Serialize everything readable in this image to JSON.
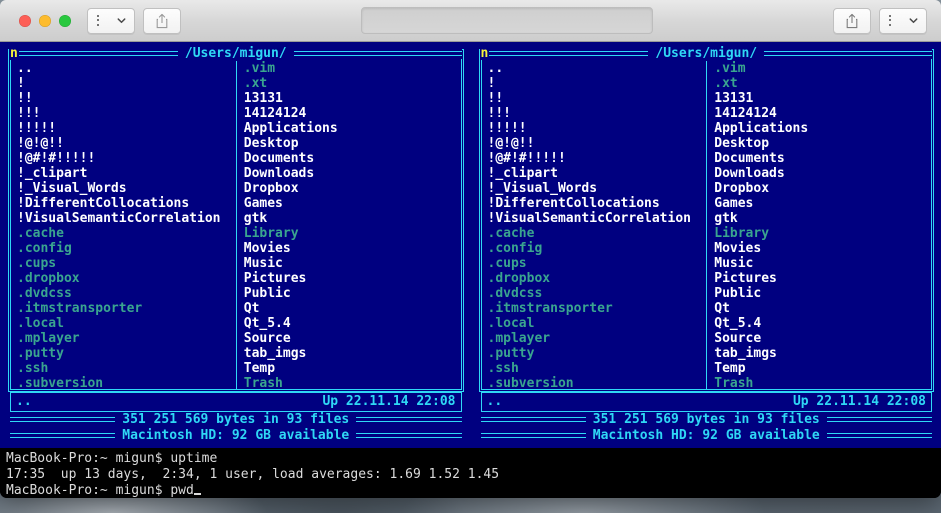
{
  "window": {
    "titlebar": {
      "traffic_lights": [
        "close",
        "minimize",
        "zoom"
      ],
      "left_menu_button": "list-menu",
      "left_share_button": "share",
      "center_field_value": "",
      "center_field_placeholder": "",
      "right_share_button": "share",
      "right_menu_button": "list-menu"
    }
  },
  "panels": [
    {
      "id": "left",
      "corner_marker": "n",
      "title": "/Users/migun/",
      "columns": [
        {
          "entries": [
            {
              "name": "..",
              "dim": false
            },
            {
              "name": "!",
              "dim": false
            },
            {
              "name": "!!",
              "dim": false
            },
            {
              "name": "!!!",
              "dim": false
            },
            {
              "name": "!!!!!",
              "dim": false
            },
            {
              "name": "!@!@!!",
              "dim": false
            },
            {
              "name": "!@#!#!!!!!",
              "dim": false
            },
            {
              "name": "!_clipart",
              "dim": false
            },
            {
              "name": "!_Visual_Words",
              "dim": false
            },
            {
              "name": "!DifferentCollocations",
              "dim": false
            },
            {
              "name": "!VisualSemanticCorrelation",
              "dim": false
            },
            {
              "name": ".cache",
              "dim": true
            },
            {
              "name": ".config",
              "dim": true
            },
            {
              "name": ".cups",
              "dim": true
            },
            {
              "name": ".dropbox",
              "dim": true
            },
            {
              "name": ".dvdcss",
              "dim": true
            },
            {
              "name": ".itmstransporter",
              "dim": true
            },
            {
              "name": ".local",
              "dim": true
            },
            {
              "name": ".mplayer",
              "dim": true
            },
            {
              "name": ".putty",
              "dim": true
            },
            {
              "name": ".ssh",
              "dim": true
            },
            {
              "name": ".subversion",
              "dim": true
            }
          ]
        },
        {
          "entries": [
            {
              "name": ".vim",
              "dim": true
            },
            {
              "name": ".xt",
              "dim": true
            },
            {
              "name": "13131",
              "dim": false
            },
            {
              "name": "14124124",
              "dim": false
            },
            {
              "name": "Applications",
              "dim": false
            },
            {
              "name": "Desktop",
              "dim": false
            },
            {
              "name": "Documents",
              "dim": false
            },
            {
              "name": "Downloads",
              "dim": false
            },
            {
              "name": "Dropbox",
              "dim": false
            },
            {
              "name": "Games",
              "dim": false
            },
            {
              "name": "gtk",
              "dim": false
            },
            {
              "name": "Library",
              "dim": true
            },
            {
              "name": "Movies",
              "dim": false
            },
            {
              "name": "Music",
              "dim": false
            },
            {
              "name": "Pictures",
              "dim": false
            },
            {
              "name": "Public",
              "dim": false
            },
            {
              "name": "Qt",
              "dim": false
            },
            {
              "name": "Qt_5.4",
              "dim": false
            },
            {
              "name": "Source",
              "dim": false
            },
            {
              "name": "tab_imgs",
              "dim": false
            },
            {
              "name": "Temp",
              "dim": false
            },
            {
              "name": "Trash",
              "dim": true
            }
          ]
        }
      ],
      "info": {
        "selected_name": "..",
        "selected_meta": "Up 22.11.14 22:08",
        "totals": "351 251 569 bytes in 93 files",
        "device": "Macintosh HD: 92 GB available"
      }
    },
    {
      "id": "right",
      "corner_marker": "n",
      "title": "/Users/migun/",
      "columns": [
        {
          "entries": [
            {
              "name": "..",
              "dim": false
            },
            {
              "name": "!",
              "dim": false
            },
            {
              "name": "!!",
              "dim": false
            },
            {
              "name": "!!!",
              "dim": false
            },
            {
              "name": "!!!!!",
              "dim": false
            },
            {
              "name": "!@!@!!",
              "dim": false
            },
            {
              "name": "!@#!#!!!!!",
              "dim": false
            },
            {
              "name": "!_clipart",
              "dim": false
            },
            {
              "name": "!_Visual_Words",
              "dim": false
            },
            {
              "name": "!DifferentCollocations",
              "dim": false
            },
            {
              "name": "!VisualSemanticCorrelation",
              "dim": false
            },
            {
              "name": ".cache",
              "dim": true
            },
            {
              "name": ".config",
              "dim": true
            },
            {
              "name": ".cups",
              "dim": true
            },
            {
              "name": ".dropbox",
              "dim": true
            },
            {
              "name": ".dvdcss",
              "dim": true
            },
            {
              "name": ".itmstransporter",
              "dim": true
            },
            {
              "name": ".local",
              "dim": true
            },
            {
              "name": ".mplayer",
              "dim": true
            },
            {
              "name": ".putty",
              "dim": true
            },
            {
              "name": ".ssh",
              "dim": true
            },
            {
              "name": ".subversion",
              "dim": true
            }
          ]
        },
        {
          "entries": [
            {
              "name": ".vim",
              "dim": true
            },
            {
              "name": ".xt",
              "dim": true
            },
            {
              "name": "13131",
              "dim": false
            },
            {
              "name": "14124124",
              "dim": false
            },
            {
              "name": "Applications",
              "dim": false
            },
            {
              "name": "Desktop",
              "dim": false
            },
            {
              "name": "Documents",
              "dim": false
            },
            {
              "name": "Downloads",
              "dim": false
            },
            {
              "name": "Dropbox",
              "dim": false
            },
            {
              "name": "Games",
              "dim": false
            },
            {
              "name": "gtk",
              "dim": false
            },
            {
              "name": "Library",
              "dim": true
            },
            {
              "name": "Movies",
              "dim": false
            },
            {
              "name": "Music",
              "dim": false
            },
            {
              "name": "Pictures",
              "dim": false
            },
            {
              "name": "Public",
              "dim": false
            },
            {
              "name": "Qt",
              "dim": false
            },
            {
              "name": "Qt_5.4",
              "dim": false
            },
            {
              "name": "Source",
              "dim": false
            },
            {
              "name": "tab_imgs",
              "dim": false
            },
            {
              "name": "Temp",
              "dim": false
            },
            {
              "name": "Trash",
              "dim": true
            }
          ]
        }
      ],
      "info": {
        "selected_name": "..",
        "selected_meta": "Up 22.11.14 22:08",
        "totals": "351 251 569 bytes in 93 files",
        "device": "Macintosh HD: 92 GB available"
      }
    }
  ],
  "shell": {
    "lines": [
      "MacBook-Pro:~ migun$ uptime",
      "17:35  up 13 days,  2:34, 1 user, load averages: 1.69 1.52 1.45",
      "MacBook-Pro:~ migun$ pwd"
    ]
  },
  "colors": {
    "panel_background": "#000080",
    "frame": "#2fd8f5",
    "file_normal": "#ffffff",
    "file_dim": "#3aa58f",
    "corner_marker": "#f6f43a",
    "terminal_background": "#000000",
    "terminal_text": "#dcdcdc"
  }
}
